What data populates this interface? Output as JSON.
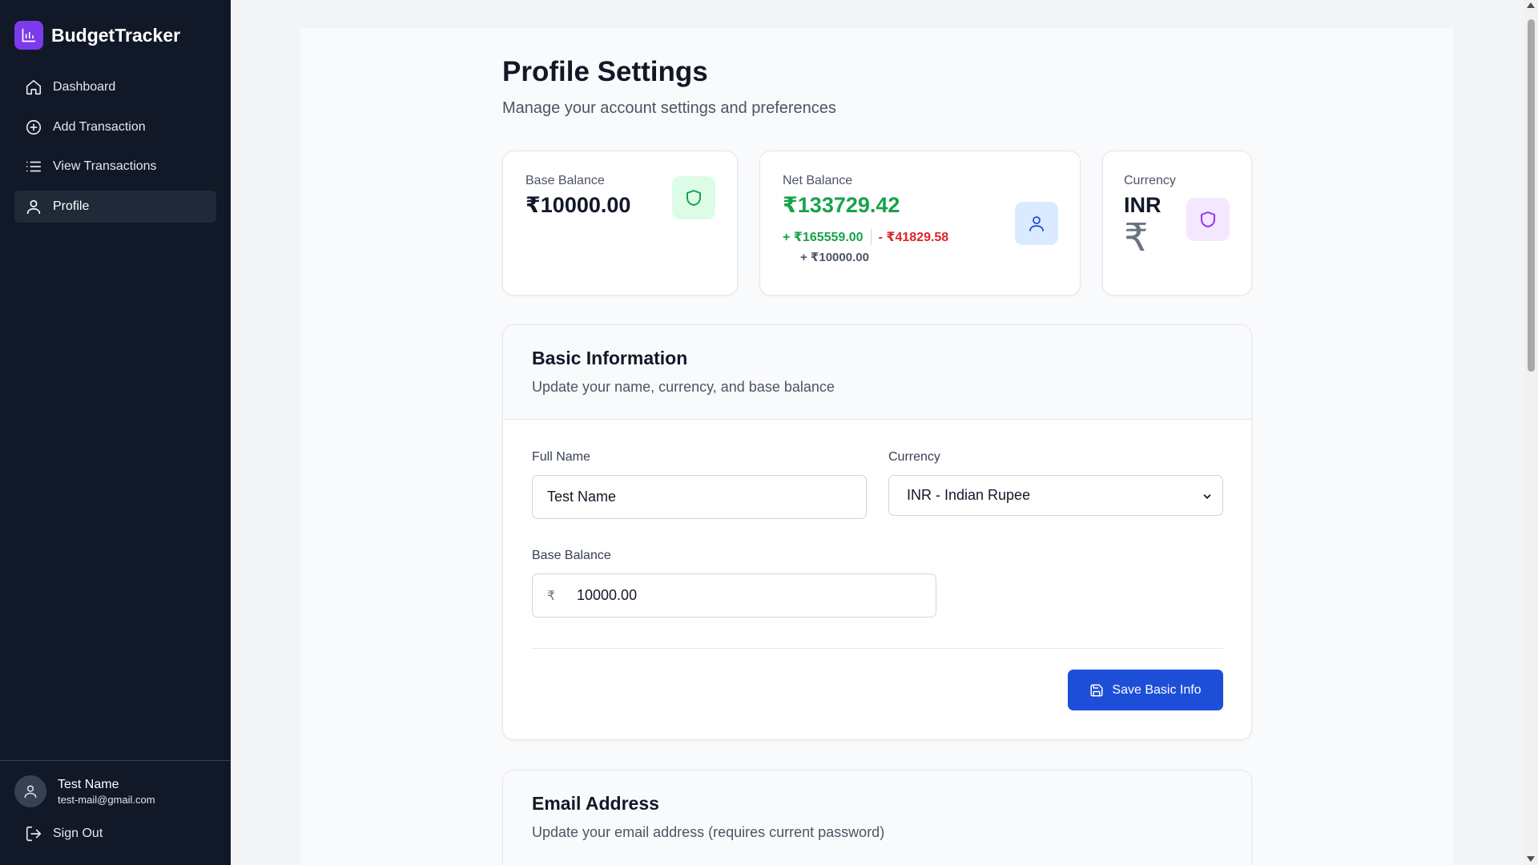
{
  "app": {
    "name": "BudgetTracker"
  },
  "sidebar": {
    "items": [
      {
        "label": "Dashboard",
        "icon": "home-icon"
      },
      {
        "label": "Add Transaction",
        "icon": "plus-circle-icon"
      },
      {
        "label": "View Transactions",
        "icon": "list-icon"
      },
      {
        "label": "Profile",
        "icon": "user-icon",
        "active": true
      }
    ],
    "user": {
      "name": "Test Name",
      "email": "test-mail@gmail.com"
    },
    "signout_label": "Sign Out"
  },
  "page": {
    "title": "Profile Settings",
    "subtitle": "Manage your account settings and preferences"
  },
  "stats": {
    "base_balance": {
      "label": "Base Balance",
      "value": "₹10000.00"
    },
    "net_balance": {
      "label": "Net Balance",
      "value": "₹133729.42",
      "income": "+ ₹165559.00",
      "expense": "- ₹41829.58",
      "base": "+ ₹10000.00"
    },
    "currency": {
      "label": "Currency",
      "value": "INR",
      "symbol": "₹"
    }
  },
  "basic_info": {
    "title": "Basic Information",
    "subtitle": "Update your name, currency, and base balance",
    "full_name_label": "Full Name",
    "full_name_value": "Test Name",
    "currency_label": "Currency",
    "currency_value": "INR - Indian Rupee",
    "base_balance_label": "Base Balance",
    "base_balance_prefix": "₹",
    "base_balance_value": "10000.00",
    "save_label": "Save Basic Info"
  },
  "email_section": {
    "title": "Email Address",
    "subtitle": "Update your email address (requires current password)"
  },
  "colors": {
    "sidebar_bg": "#111827",
    "brand_accent": "#7c3aed",
    "income": "#16a34a",
    "expense": "#dc2626",
    "primary_button": "#1d4ed8"
  }
}
